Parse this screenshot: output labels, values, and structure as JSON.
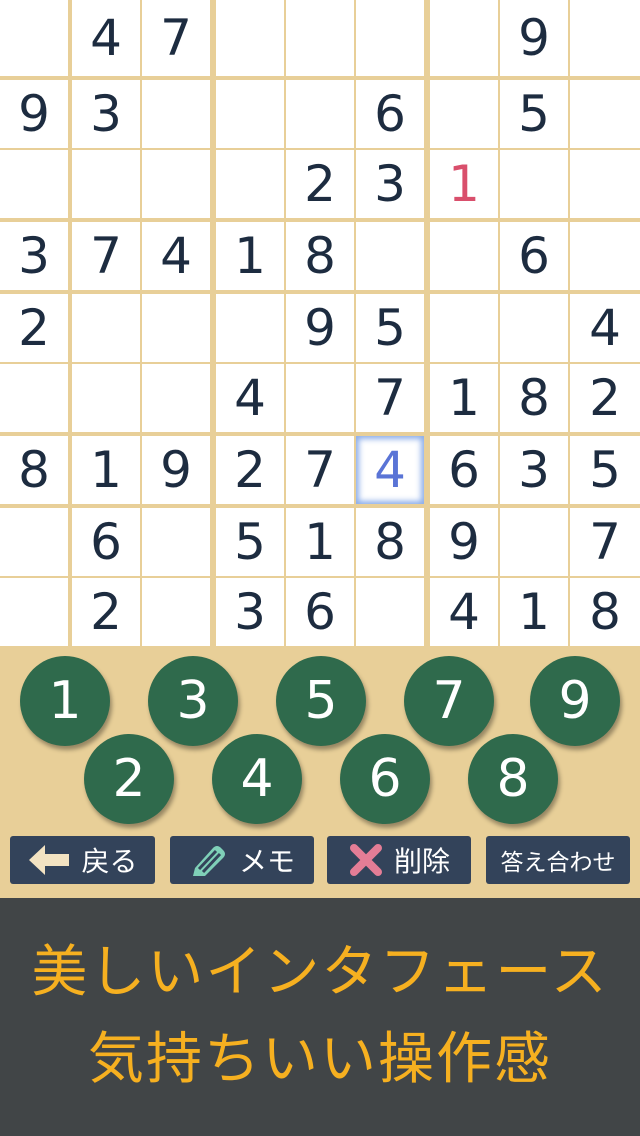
{
  "board": {
    "cells": [
      [
        "",
        "4",
        "7",
        "",
        "",
        "",
        "",
        "9",
        ""
      ],
      [
        "9",
        "3",
        "",
        "",
        "",
        "6",
        "",
        "5",
        ""
      ],
      [
        "",
        "",
        "",
        "",
        "2",
        "3",
        "1",
        "",
        ""
      ],
      [
        "3",
        "7",
        "4",
        "1",
        "8",
        "",
        "",
        "6",
        ""
      ],
      [
        "2",
        "",
        "",
        "",
        "9",
        "5",
        "",
        "",
        "4"
      ],
      [
        "",
        "",
        "",
        "4",
        "",
        "7",
        "1",
        "8",
        "2"
      ],
      [
        "8",
        "1",
        "9",
        "2",
        "7",
        "4",
        "6",
        "3",
        "5"
      ],
      [
        "",
        "6",
        "",
        "5",
        "1",
        "8",
        "9",
        "",
        "7"
      ],
      [
        "",
        "2",
        "",
        "3",
        "6",
        "",
        "4",
        "1",
        "8"
      ]
    ],
    "user_entered": [
      [
        2,
        6
      ]
    ],
    "selected": [
      6,
      5
    ]
  },
  "number_pad": [
    "1",
    "2",
    "3",
    "4",
    "5",
    "6",
    "7",
    "8",
    "9"
  ],
  "toolbar": {
    "back_label": "戻る",
    "memo_label": "メモ",
    "delete_label": "削除",
    "check_label": "答え合わせ"
  },
  "banner": {
    "line1": "美しいインタフェース",
    "line2": "気持ちいい操作感"
  },
  "colors": {
    "background": "#e8cf98",
    "given_digit": "#1d2c40",
    "user_digit": "#d94f6c",
    "selected_digit": "#5a74d6",
    "number_button": "#2f6a4c",
    "toolbar_button": "#33435a",
    "banner_bg": "#414547",
    "banner_text": "#f6b020"
  },
  "icons": {
    "back": "arrow-left-icon",
    "memo": "pencil-icon",
    "delete": "cross-icon"
  }
}
